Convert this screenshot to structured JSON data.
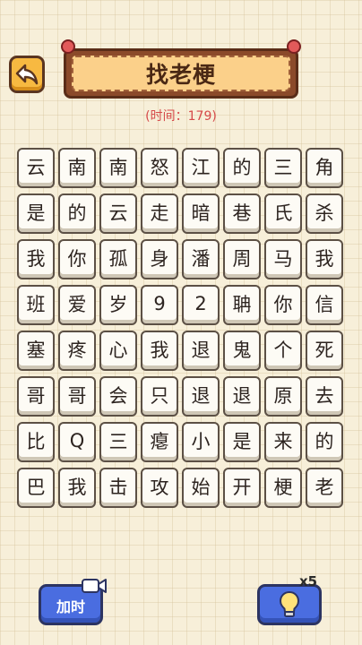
{
  "header": {
    "title": "找老梗",
    "timer": "(时间：179)"
  },
  "grid": [
    [
      "云",
      "南",
      "南",
      "怒",
      "江",
      "的",
      "三",
      "角"
    ],
    [
      "是",
      "的",
      "云",
      "走",
      "暗",
      "巷",
      "氏",
      "杀"
    ],
    [
      "我",
      "你",
      "孤",
      "身",
      "潘",
      "周",
      "马",
      "我"
    ],
    [
      "班",
      "爱",
      "岁",
      "9",
      "2",
      "聃",
      "你",
      "信"
    ],
    [
      "塞",
      "疼",
      "心",
      "我",
      "退",
      "鬼",
      "个",
      "死"
    ],
    [
      "哥",
      "哥",
      "会",
      "只",
      "退",
      "退",
      "原",
      "去"
    ],
    [
      "比",
      "Q",
      "三",
      "瘪",
      "小",
      "是",
      "来",
      "的"
    ],
    [
      "巴",
      "我",
      "击",
      "攻",
      "始",
      "开",
      "梗",
      "老"
    ]
  ],
  "controls": {
    "add_time_label": "加时",
    "hint_count": "x5"
  },
  "colors": {
    "background": "#f7efd9",
    "button_blue": "#4a6de0",
    "back_orange": "#f7b941",
    "banner_wood": "#8b4a2a",
    "timer_red": "#d64a4a"
  },
  "icons": {
    "back": "back-arrow-icon",
    "video": "video-camera-icon",
    "hint": "lightbulb-icon"
  }
}
